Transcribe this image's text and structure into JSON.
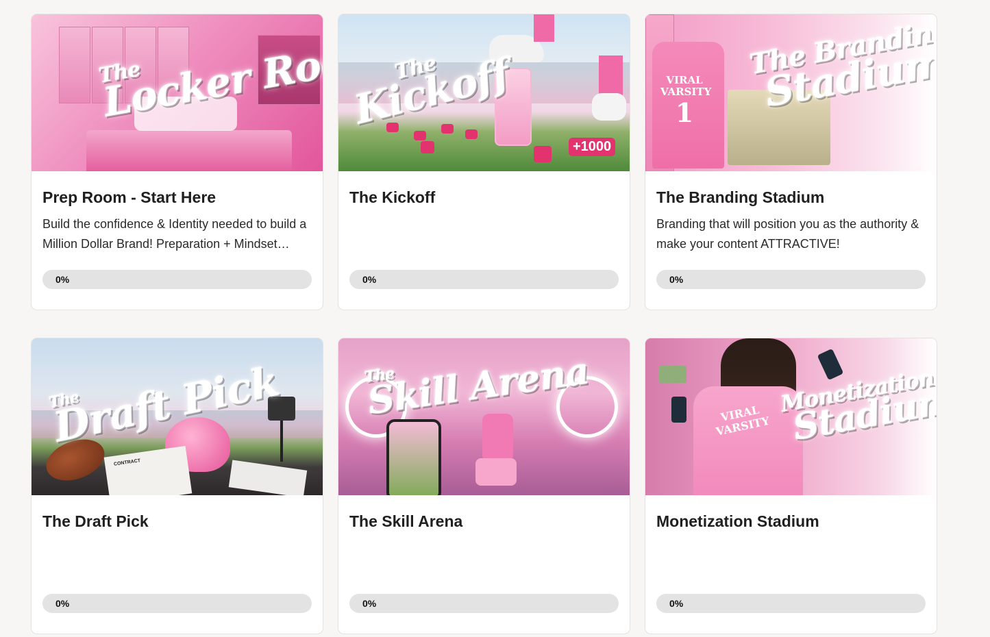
{
  "colors": {
    "page_background": "#f7f6f5",
    "card_background": "#ffffff",
    "progress_track": "#e3e3e3",
    "brand_pink": "#e75aa3"
  },
  "courses": [
    {
      "title": "Prep Room - Start Here",
      "description": "Build the confidence & Identity needed to build a Million Dollar Brand! Preparation + Mindset before the big game.",
      "progress": 0,
      "progress_label": "0%",
      "cover": {
        "text_small": "The",
        "text_big": "Locker Room"
      }
    },
    {
      "title": "The Kickoff",
      "description": "",
      "progress": 0,
      "progress_label": "0%",
      "cover": {
        "text_small": "The",
        "text_big": "Kickoff",
        "badge": "+1000"
      }
    },
    {
      "title": "The Branding Stadium",
      "description": "Branding that will position you as the authority & make your content ATTRACTIVE!",
      "progress": 0,
      "progress_label": "0%",
      "cover": {
        "text_small": "The Branding",
        "text_big": "Stadium",
        "jersey_text": "VIRAL VARSITY",
        "jersey_number": "1"
      }
    },
    {
      "title": "The Draft Pick",
      "description": "",
      "progress": 0,
      "progress_label": "0%",
      "cover": {
        "text_small": "The",
        "text_big": "Draft Pick",
        "paper_label": "CONTRACT"
      }
    },
    {
      "title": "The Skill Arena",
      "description": "",
      "progress": 0,
      "progress_label": "0%",
      "cover": {
        "text_small": "The",
        "text_big": "Skill Arena"
      }
    },
    {
      "title": "Monetization Stadium",
      "description": "",
      "progress": 0,
      "progress_label": "0%",
      "cover": {
        "text_small": "Monetization",
        "text_big": "Stadium",
        "jersey_text": "VIRAL VARSITY"
      }
    }
  ]
}
